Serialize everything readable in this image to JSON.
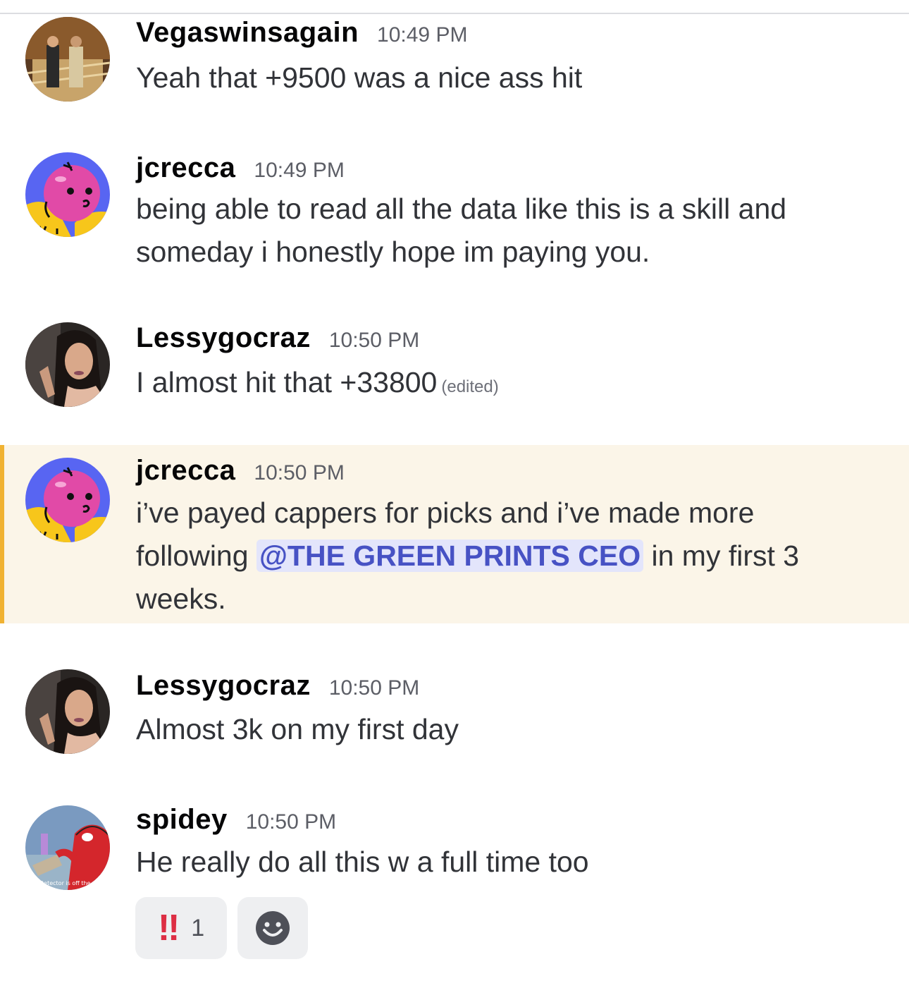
{
  "messages": [
    {
      "username": "Vegaswinsagain",
      "time": "10:49 PM",
      "text": "Yeah that +9500 was a nice ass hit"
    },
    {
      "username": "jcrecca",
      "time": "10:49 PM",
      "text_line1": "being able to read all the data like this is a skill and",
      "text_line2": "someday i honestly hope im paying you."
    },
    {
      "username": "Lessygocraz",
      "time": "10:50 PM",
      "text": "I almost hit that +33800",
      "edited": "(edited)"
    },
    {
      "username": "jcrecca",
      "time": "10:50 PM",
      "text_line1": "i’ve payed cappers for picks and i’ve made more",
      "text_pre": "following ",
      "mention": "@THE GREEN PRINTS CEO",
      "text_post": " in my first 3",
      "text_line3": "weeks."
    },
    {
      "username": "Lessygocraz",
      "time": "10:50 PM",
      "text": "Almost 3k on my first day"
    },
    {
      "username": "spidey",
      "time": "10:50 PM",
      "text": "He really do all this w a full time too",
      "avatar_caption": "Detector is off the"
    }
  ],
  "reactions": [
    {
      "emoji": "‼",
      "count": "1"
    },
    {
      "emoji": "add-reaction"
    }
  ],
  "colors": {
    "mention_bg": "#e3e5fb",
    "mention_text": "#4752c4",
    "highlight_bg": "#fbf5e8",
    "highlight_bar": "#f0b232"
  }
}
